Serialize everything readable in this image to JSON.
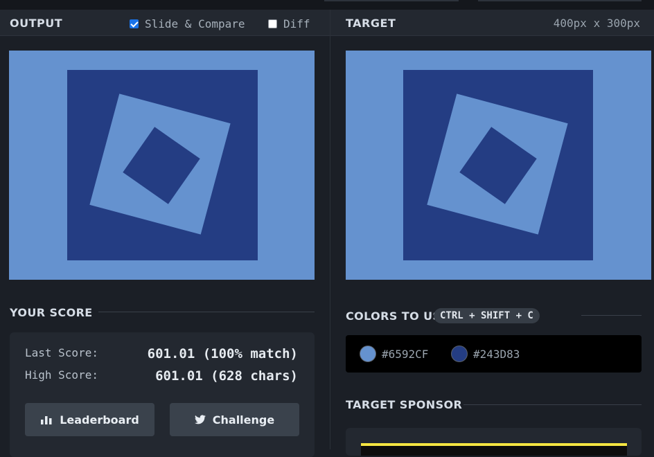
{
  "output_panel": {
    "title": "OUTPUT",
    "slide_compare_label": "Slide & Compare",
    "slide_compare_checked": true,
    "diff_label": "Diff",
    "diff_checked": false
  },
  "target_panel": {
    "title": "TARGET",
    "dimensions": "400px x 300px"
  },
  "score": {
    "section_title": "YOUR SCORE",
    "last_label": "Last Score:",
    "last_value": "601.01 (100% match)",
    "high_label": "High Score:",
    "high_value": "601.01 (628 chars)",
    "leaderboard_label": "Leaderboard",
    "challenge_label": "Challenge"
  },
  "colors": {
    "section_title": "COLORS TO USE",
    "shortcut": "CTRL + SHIFT + C",
    "swatches": [
      {
        "hex": "#6592CF",
        "color": "#6592CF"
      },
      {
        "hex": "#243D83",
        "color": "#243D83"
      }
    ]
  },
  "sponsor": {
    "section_title": "TARGET SPONSOR"
  },
  "palette": {
    "background": "#1b1f26",
    "light_blue": "#6592CF",
    "dark_blue": "#243D83",
    "checkbox_accent": "#1a73e8",
    "sponsor_accent": "#f5e642"
  }
}
